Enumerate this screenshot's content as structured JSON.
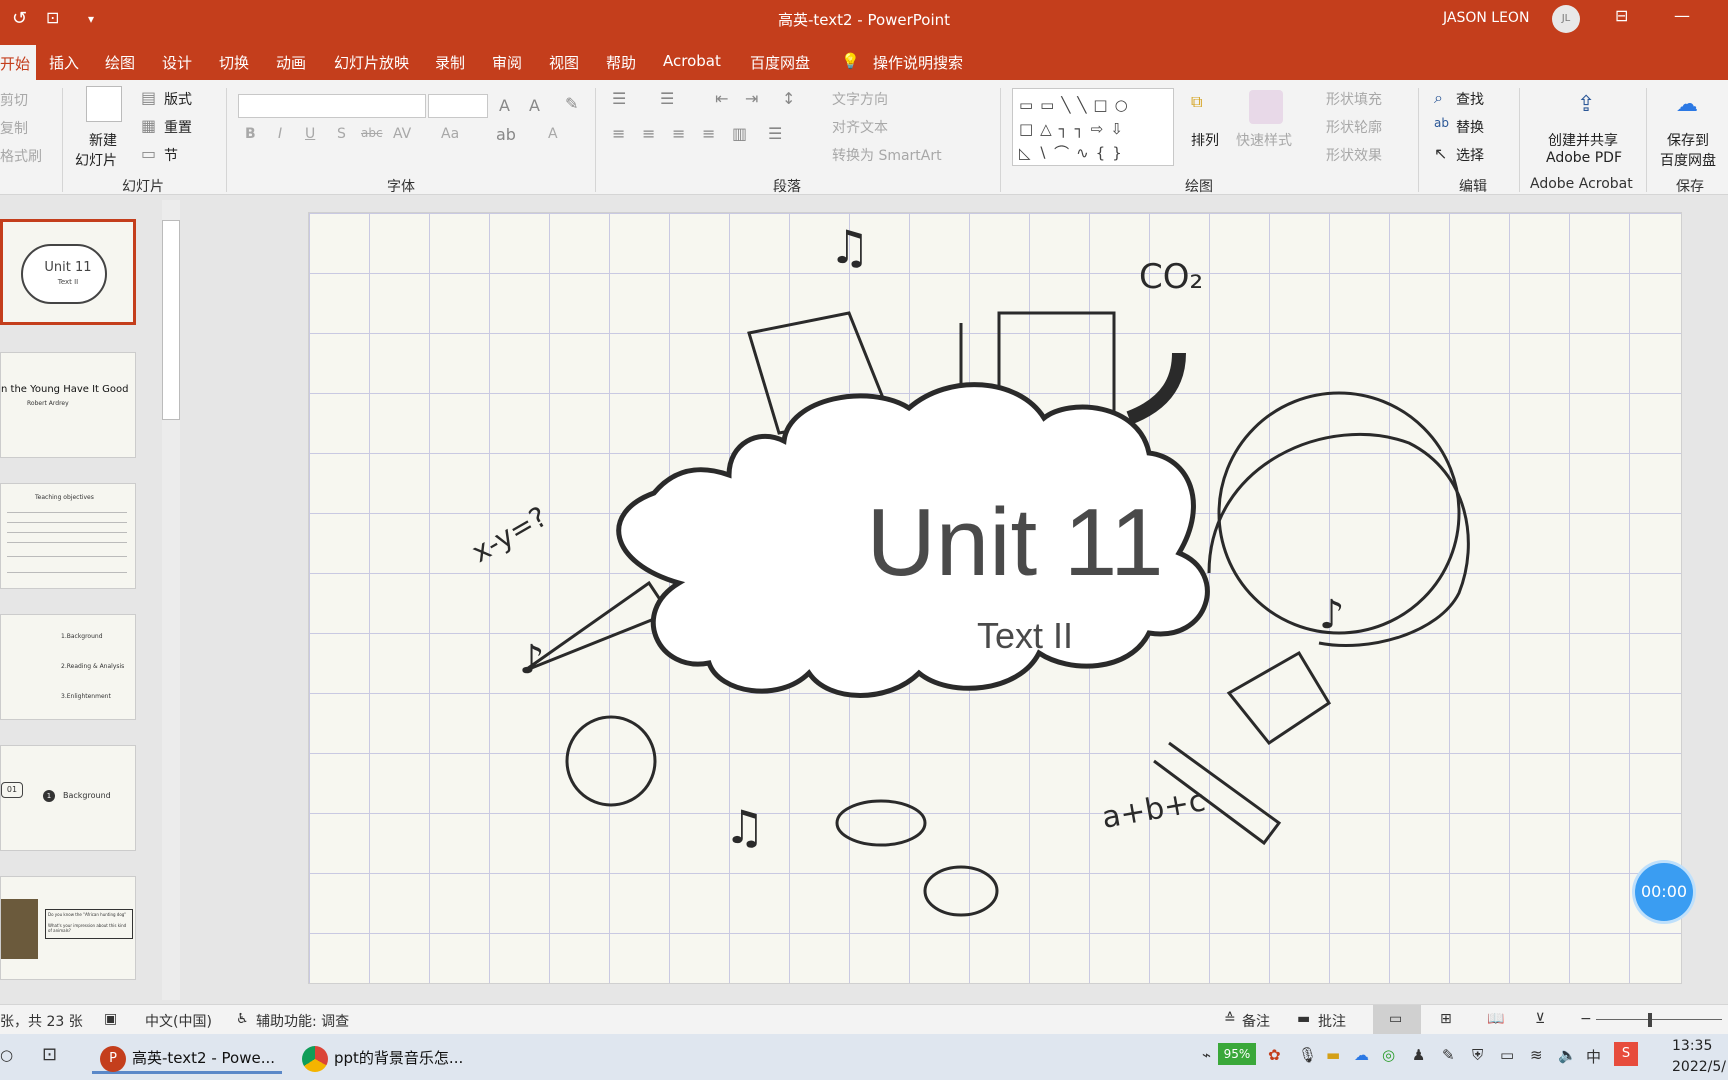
{
  "titlebar": {
    "document_title": "高英-text2  -  PowerPoint",
    "user_name": "JASON LEON",
    "user_initials": "JL",
    "quick_access": [
      "autosave-icon",
      "present-icon",
      "customize-icon"
    ]
  },
  "tabs": {
    "active": "开始",
    "items": [
      "插入",
      "绘图",
      "设计",
      "切换",
      "动画",
      "幻灯片放映",
      "录制",
      "审阅",
      "视图",
      "帮助",
      "Acrobat",
      "百度网盘"
    ],
    "search_label": "操作说明搜索"
  },
  "ribbon": {
    "clipboard": {
      "cut": "剪切",
      "copy": "复制",
      "format_painter": "格式刷"
    },
    "slides": {
      "new_slide": "新建",
      "new_slide_2": "幻灯片",
      "layout": "版式",
      "reset": "重置",
      "section": "节",
      "label": "幻灯片"
    },
    "font": {
      "label": "字体",
      "bold": "B",
      "italic": "I",
      "underline": "U",
      "shadow": "S",
      "strike": "abc",
      "spacing": "AV",
      "case": "Aa",
      "color": "A"
    },
    "paragraph": {
      "label": "段落",
      "text_direction": "文字方向",
      "align_text": "对齐文本",
      "smartart": "转换为 SmartArt"
    },
    "drawing": {
      "label": "绘图",
      "arrange": "排列",
      "quick_styles": "快速样式",
      "shape_fill": "形状填充",
      "shape_outline": "形状轮廓",
      "shape_effects": "形状效果"
    },
    "editing": {
      "label": "编辑",
      "find": "查找",
      "replace": "替换",
      "select": "选择"
    },
    "acrobat": {
      "line1": "创建并共享",
      "line2": "Adobe PDF",
      "label": "Adobe Acrobat"
    },
    "save": {
      "line1": "保存到",
      "line2": "百度网盘",
      "label": "保存"
    }
  },
  "thumbnails": [
    {
      "title": "Unit 11",
      "subtitle": "Text II",
      "selected": true
    },
    {
      "title": "n the Young Have It Good",
      "subtitle": "Robert Ardrey"
    },
    {
      "title": "Teaching objectives"
    },
    {
      "items": [
        "1.Background",
        "2.Reading & Analysis",
        "3.Enlightenment"
      ]
    },
    {
      "number": "01",
      "label": "Background",
      "badge": "1"
    },
    {
      "lines": [
        "Do you know the \"African hunting dog\"",
        "What's your impression about this kind of animals?"
      ]
    }
  ],
  "slide": {
    "title": "Unit 11",
    "subtitle": "Text II",
    "doodles": {
      "formula1": "x-y=?",
      "formula2": "a+b+c",
      "chem": "CO₂"
    }
  },
  "timer": "00:00",
  "status": {
    "slide_count": "张，共 23 张",
    "language": "中文(中国)",
    "accessibility": "辅助功能: 调查",
    "notes": "备注",
    "comments": "批注"
  },
  "taskbar": {
    "apps": [
      {
        "label": "高英-text2 - Powe..."
      },
      {
        "label": "ppt的背景音乐怎..."
      }
    ],
    "battery": "95%",
    "time": "13:35",
    "date": "2022/5/"
  },
  "colors": {
    "accent": "#c43e1c",
    "timer": "#3a9df2"
  }
}
